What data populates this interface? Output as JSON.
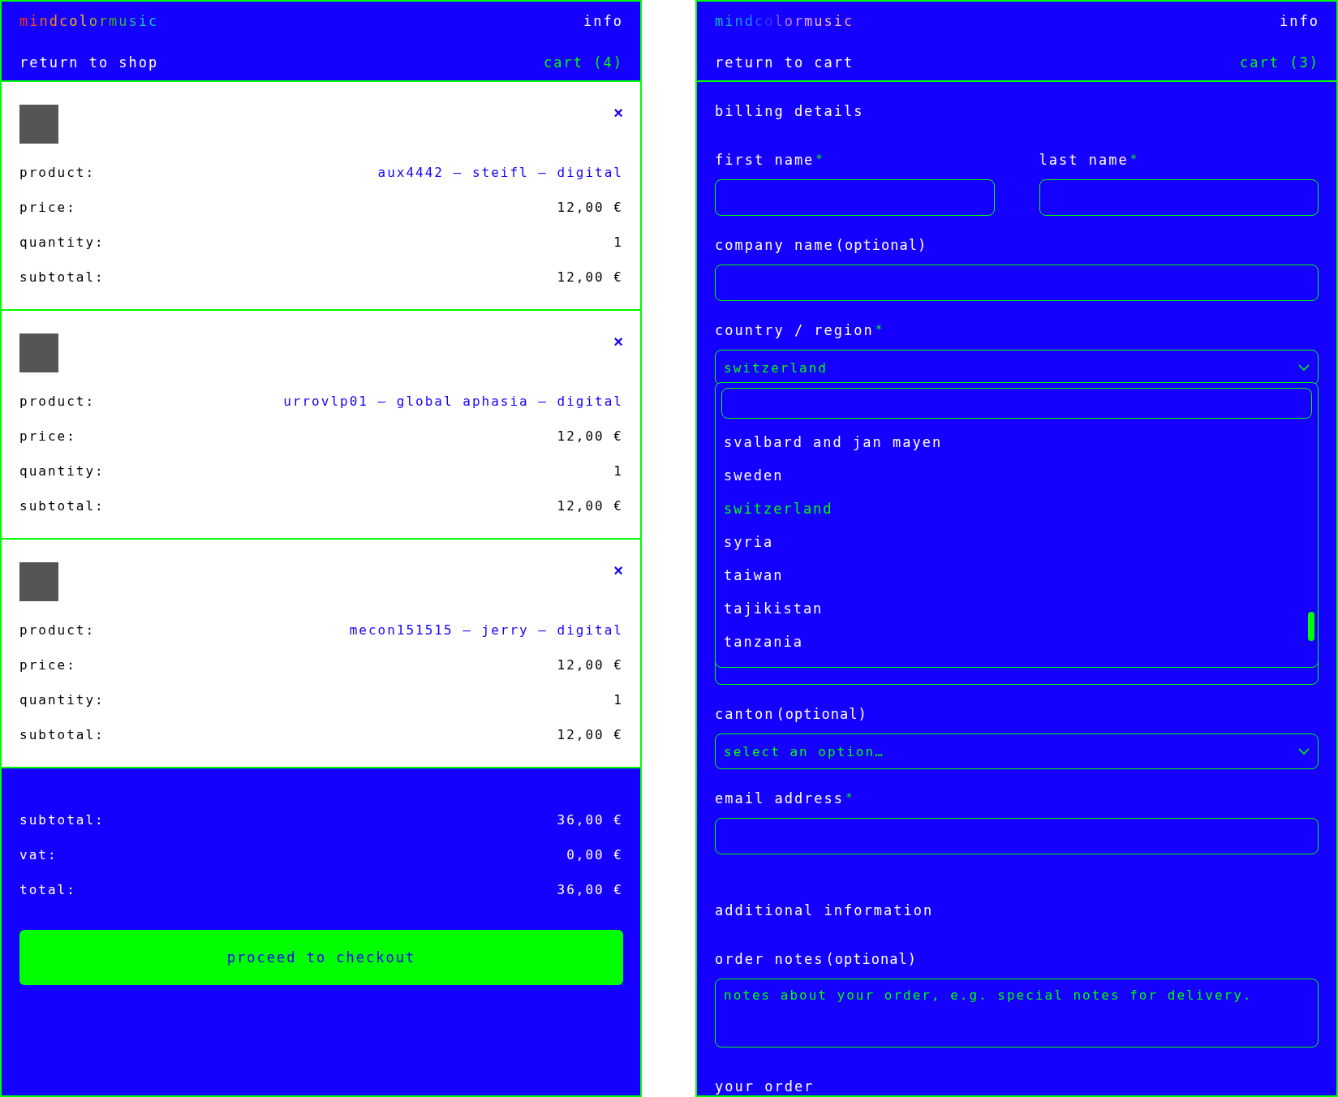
{
  "cart_panel": {
    "header": {
      "logo": "mindcolormusic",
      "info_link": "info",
      "back_link": "return to shop",
      "cart_link": "cart (4)"
    },
    "items": [
      {
        "remove": "×",
        "rows": [
          {
            "label": "product:",
            "value": "aux4442 – steifl – digital",
            "kind": "link"
          },
          {
            "label": "price:",
            "value": "12,00",
            "currency": "€",
            "kind": "money"
          },
          {
            "label": "quantity:",
            "value": "1",
            "kind": "plain"
          },
          {
            "label": "subtotal:",
            "value": "12,00",
            "currency": "€",
            "kind": "money"
          }
        ]
      },
      {
        "remove": "×",
        "rows": [
          {
            "label": "product:",
            "value": "urrovlp01 – global aphasia – digital",
            "kind": "link"
          },
          {
            "label": "price:",
            "value": "12,00",
            "currency": "€",
            "kind": "money"
          },
          {
            "label": "quantity:",
            "value": "1",
            "kind": "plain"
          },
          {
            "label": "subtotal:",
            "value": "12,00",
            "currency": "€",
            "kind": "money"
          }
        ]
      },
      {
        "remove": "×",
        "rows": [
          {
            "label": "product:",
            "value": "mecon151515 – jerry – digital",
            "kind": "link"
          },
          {
            "label": "price:",
            "value": "12,00",
            "currency": "€",
            "kind": "money"
          },
          {
            "label": "quantity:",
            "value": "1",
            "kind": "plain"
          },
          {
            "label": "subtotal:",
            "value": "12,00",
            "currency": "€",
            "kind": "money"
          }
        ]
      }
    ],
    "totals": [
      {
        "label": "subtotal:",
        "value": "36,00",
        "currency": "€"
      },
      {
        "label": "vat:",
        "value": "0,00",
        "currency": "€"
      },
      {
        "label": "total:",
        "value": "36,00",
        "currency": "€"
      }
    ],
    "checkout_button": "proceed to checkout"
  },
  "checkout_panel": {
    "header": {
      "logo": "mindcolormusic",
      "info_link": "info",
      "back_link": "return to cart",
      "cart_link": "cart (3)"
    },
    "billing_title": "billing details",
    "name_fields": [
      {
        "label": "first name",
        "required_mark": "*"
      },
      {
        "label": "last name",
        "required_mark": "*"
      }
    ],
    "company_field": {
      "label": "company name",
      "note": "(optional)"
    },
    "country_field": {
      "label": "country / region",
      "required_mark": "*",
      "value": "switzerland",
      "expanded": true,
      "options": [
        {
          "label": "svalbard and jan mayen",
          "selected": false
        },
        {
          "label": "sweden",
          "selected": false
        },
        {
          "label": "switzerland",
          "selected": true
        },
        {
          "label": "syria",
          "selected": false
        },
        {
          "label": "taiwan",
          "selected": false
        },
        {
          "label": "tajikistan",
          "selected": false
        },
        {
          "label": "tanzania",
          "selected": false
        }
      ]
    },
    "canton_field": {
      "label": "canton",
      "note": "(optional)",
      "placeholder": "select an option…"
    },
    "email_field": {
      "label": "email address",
      "required_mark": "*"
    },
    "additional_title": "additional information",
    "notes_field": {
      "label": "order notes",
      "note": "(optional)",
      "placeholder": "notes about your order, e.g. special notes for delivery."
    },
    "order_title": "your order"
  }
}
